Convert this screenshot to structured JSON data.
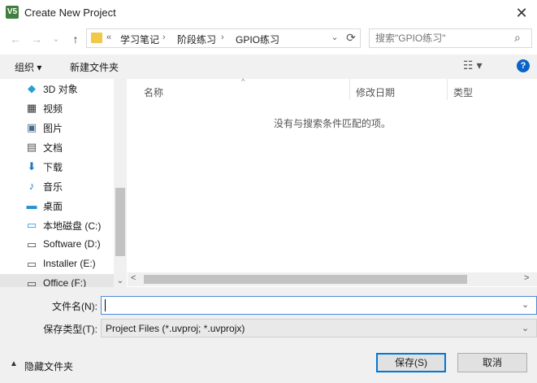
{
  "window": {
    "title": "Create New Project",
    "app_icon": "V5",
    "close_glyph": "✕"
  },
  "nav": {
    "back_glyph": "←",
    "forward_glyph": "→",
    "recent_glyph": "⌄",
    "up_glyph": "↑",
    "address": {
      "overflow": "«",
      "crumbs": [
        "学习笔记",
        "阶段练习",
        "GPIO练习"
      ],
      "separator": "›"
    },
    "search_placeholder": "搜索\"GPIO练习\""
  },
  "toolbar": {
    "organize_label": "组织 ▾",
    "new_folder_label": "新建文件夹",
    "view_glyph": "☷ ▾",
    "help_glyph": "?"
  },
  "sidebar": {
    "items": [
      {
        "label": "3D 对象",
        "icon": "cube-icon",
        "glyph": "◆",
        "color": "#2a9fd6"
      },
      {
        "label": "视频",
        "icon": "film-icon",
        "glyph": "▦",
        "color": "#333333"
      },
      {
        "label": "图片",
        "icon": "picture-icon",
        "glyph": "▣",
        "color": "#4a6a8a"
      },
      {
        "label": "文档",
        "icon": "document-icon",
        "glyph": "▤",
        "color": "#555555"
      },
      {
        "label": "下载",
        "icon": "download-icon",
        "glyph": "⬇",
        "color": "#1e78c8"
      },
      {
        "label": "音乐",
        "icon": "music-icon",
        "glyph": "♪",
        "color": "#1e78c8"
      },
      {
        "label": "桌面",
        "icon": "desktop-icon",
        "glyph": "▬",
        "color": "#2a8fd6"
      },
      {
        "label": "本地磁盘 (C:)",
        "icon": "windows-drive-icon",
        "glyph": "▭",
        "color": "#2a8fd6"
      },
      {
        "label": "Software (D:)",
        "icon": "drive-icon",
        "glyph": "▭",
        "color": "#444444"
      },
      {
        "label": "Installer (E:)",
        "icon": "drive-icon",
        "glyph": "▭",
        "color": "#444444"
      },
      {
        "label": "Office (F:)",
        "icon": "drive-icon",
        "glyph": "▭",
        "color": "#444444"
      }
    ],
    "scroll_down_glyph": "⌄"
  },
  "filelist": {
    "columns": [
      "名称",
      "修改日期",
      "类型"
    ],
    "sort_glyph": "^",
    "empty_message": "没有与搜索条件匹配的项。",
    "scroll_left": "<",
    "scroll_right": ">"
  },
  "form": {
    "filename_label": "文件名(N):",
    "filename_value": "",
    "filetype_label": "保存类型(T):",
    "filetype_value": "Project Files (*.uvproj; *.uvprojx)",
    "dropdown_glyph": "⌄"
  },
  "footer": {
    "hide_folders_glyph": "▲",
    "hide_folders_label": "隐藏文件夹",
    "save_label": "保存(S)",
    "cancel_label": "取消"
  },
  "colors": {
    "accent": "#0078d7",
    "help": "#0a64c8",
    "folder": "#f2c84b"
  }
}
